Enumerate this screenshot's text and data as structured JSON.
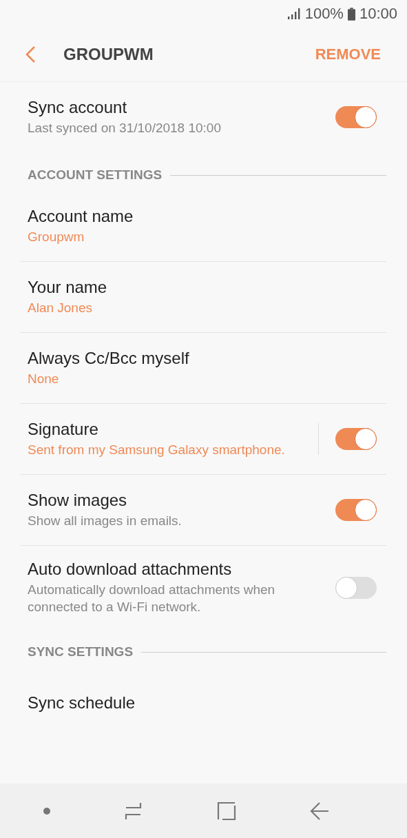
{
  "status_bar": {
    "battery": "100%",
    "time": "10:00"
  },
  "header": {
    "title": "GROUPWM",
    "action": "REMOVE"
  },
  "items": [
    {
      "kind": "toggle",
      "title": "Sync account",
      "subtitle": "Last synced on 31/10/2018  10:00",
      "on": true
    },
    {
      "kind": "section",
      "title": "ACCOUNT SETTINGS"
    },
    {
      "kind": "value",
      "title": "Account name",
      "subtitle": "Groupwm"
    },
    {
      "kind": "value",
      "title": "Your name",
      "subtitle": "Alan Jones"
    },
    {
      "kind": "value",
      "title": "Always Cc/Bcc myself",
      "subtitle": "None"
    },
    {
      "kind": "value_toggle",
      "title": "Signature",
      "subtitle": "Sent from my Samsung Galaxy smartphone.",
      "on": true
    },
    {
      "kind": "toggle",
      "title": "Show images",
      "subtitle": "Show all images in emails.",
      "on": true
    },
    {
      "kind": "toggle",
      "title": "Auto download attachments",
      "subtitle": "Automatically download attachments when connected to a Wi-Fi network.",
      "on": false
    },
    {
      "kind": "section",
      "title": "SYNC SETTINGS"
    },
    {
      "kind": "value",
      "title": "Sync schedule"
    }
  ]
}
